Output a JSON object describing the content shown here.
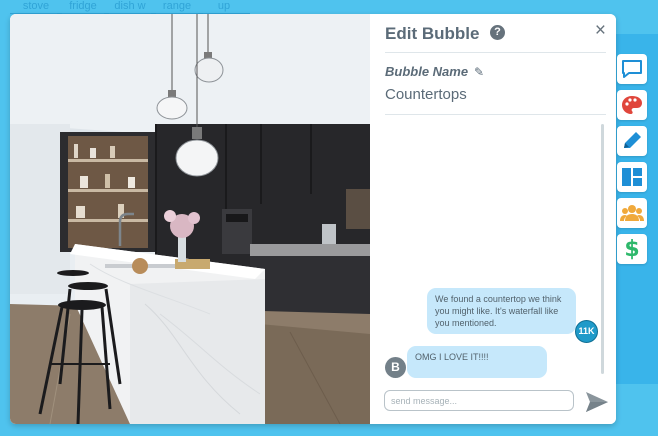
{
  "background_tabs": [
    "stove",
    "fridge",
    "dish w",
    "range",
    "up cabinets"
  ],
  "modal": {
    "title": "Edit Bubble",
    "help_icon": "question-circle-icon",
    "close_label": "×",
    "bubble_name_label": "Bubble Name",
    "bubble_name_value": "Countertops"
  },
  "chat": {
    "messages": [
      {
        "sender": "11K",
        "text": "We found a countertop we think you might like.  It's waterfall like you mentioned."
      },
      {
        "sender": "B",
        "text": "OMG I LOVE IT!!!!"
      }
    ],
    "input_placeholder": "send message..."
  },
  "toolbar": {
    "items": [
      "chat-bubble-icon",
      "palette-icon",
      "pencil-icon",
      "layout-icon",
      "users-icon",
      "dollar-icon"
    ]
  },
  "colors": {
    "accent": "#1e8fd6",
    "page_background": "#4fc3ee",
    "bubble": "#c6e8fb",
    "dollar": "#2eb86b"
  }
}
